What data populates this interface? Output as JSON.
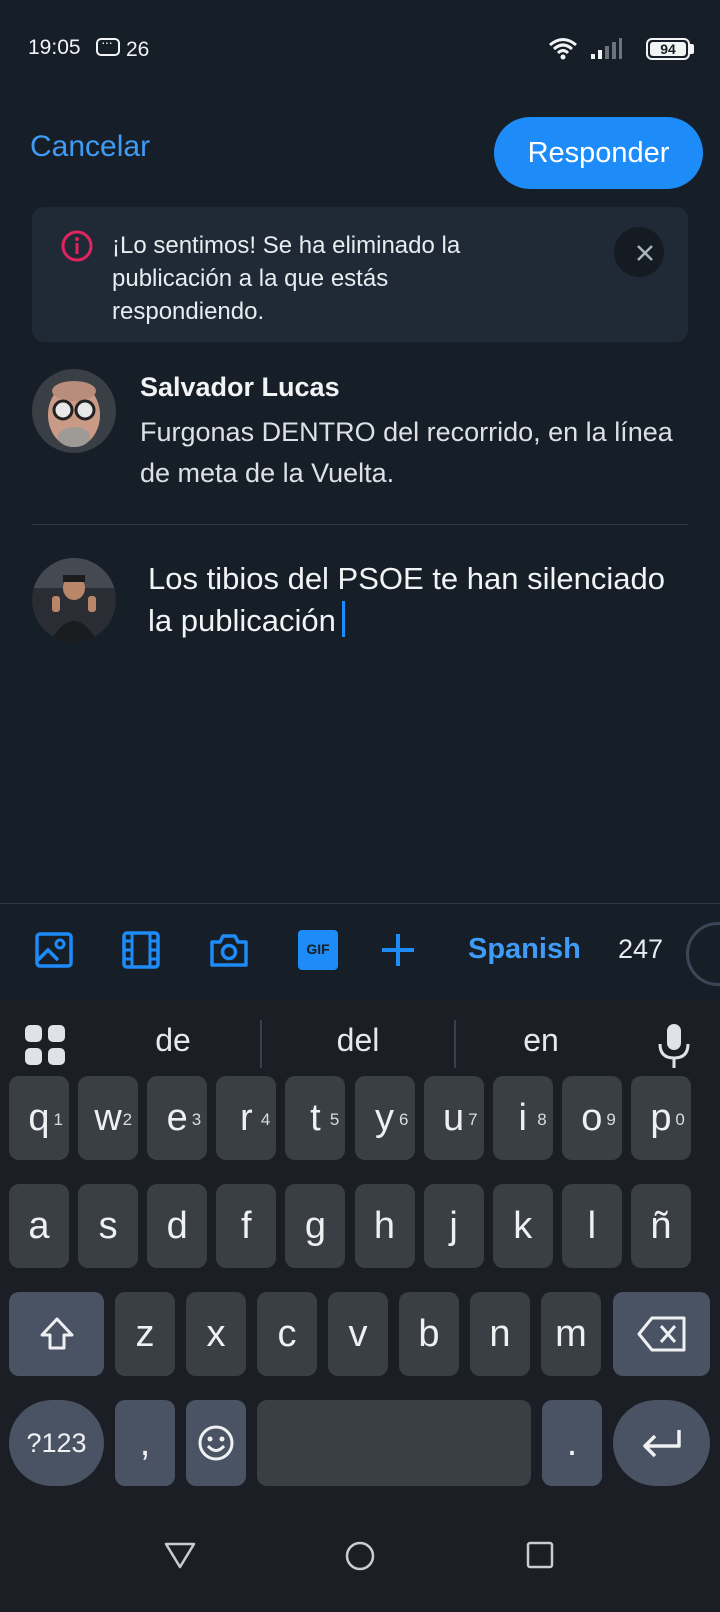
{
  "status_bar": {
    "time": "19:05",
    "notification_count": "26",
    "battery": "94"
  },
  "header": {
    "cancel_label": "Cancelar",
    "reply_label": "Responder"
  },
  "alert": {
    "message": "¡Lo sentimos! Se ha eliminado la publicación a la que estás respondiendo."
  },
  "quoted_post": {
    "author": "Salvador Lucas",
    "text": "Furgonas DENTRO del recorrido, en la línea de meta de la Vuelta."
  },
  "compose": {
    "text": "Los tibios del PSOE te han silenciado la publicación"
  },
  "toolbar": {
    "icons": [
      "image-icon",
      "video-icon",
      "camera-icon",
      "gif-icon",
      "plus-icon"
    ],
    "gif_label": "GIF",
    "language": "Spanish",
    "char_count": "247"
  },
  "keyboard": {
    "suggestions": [
      "de",
      "del",
      "en"
    ],
    "row1": [
      {
        "key": "q",
        "hint": "1"
      },
      {
        "key": "w",
        "hint": "2"
      },
      {
        "key": "e",
        "hint": "3"
      },
      {
        "key": "r",
        "hint": "4"
      },
      {
        "key": "t",
        "hint": "5"
      },
      {
        "key": "y",
        "hint": "6"
      },
      {
        "key": "u",
        "hint": "7"
      },
      {
        "key": "i",
        "hint": "8"
      },
      {
        "key": "o",
        "hint": "9"
      },
      {
        "key": "p",
        "hint": "0"
      }
    ],
    "row2": [
      "a",
      "s",
      "d",
      "f",
      "g",
      "h",
      "j",
      "k",
      "l",
      "ñ"
    ],
    "row3": [
      "z",
      "x",
      "c",
      "v",
      "b",
      "n",
      "m"
    ],
    "symbols_label": "?123",
    "comma_label": ",",
    "period_label": "."
  },
  "colors": {
    "background": "#161e27",
    "accent": "#1d8cf8",
    "link": "#3f9bf5",
    "alert_icon": "#e0245e"
  }
}
